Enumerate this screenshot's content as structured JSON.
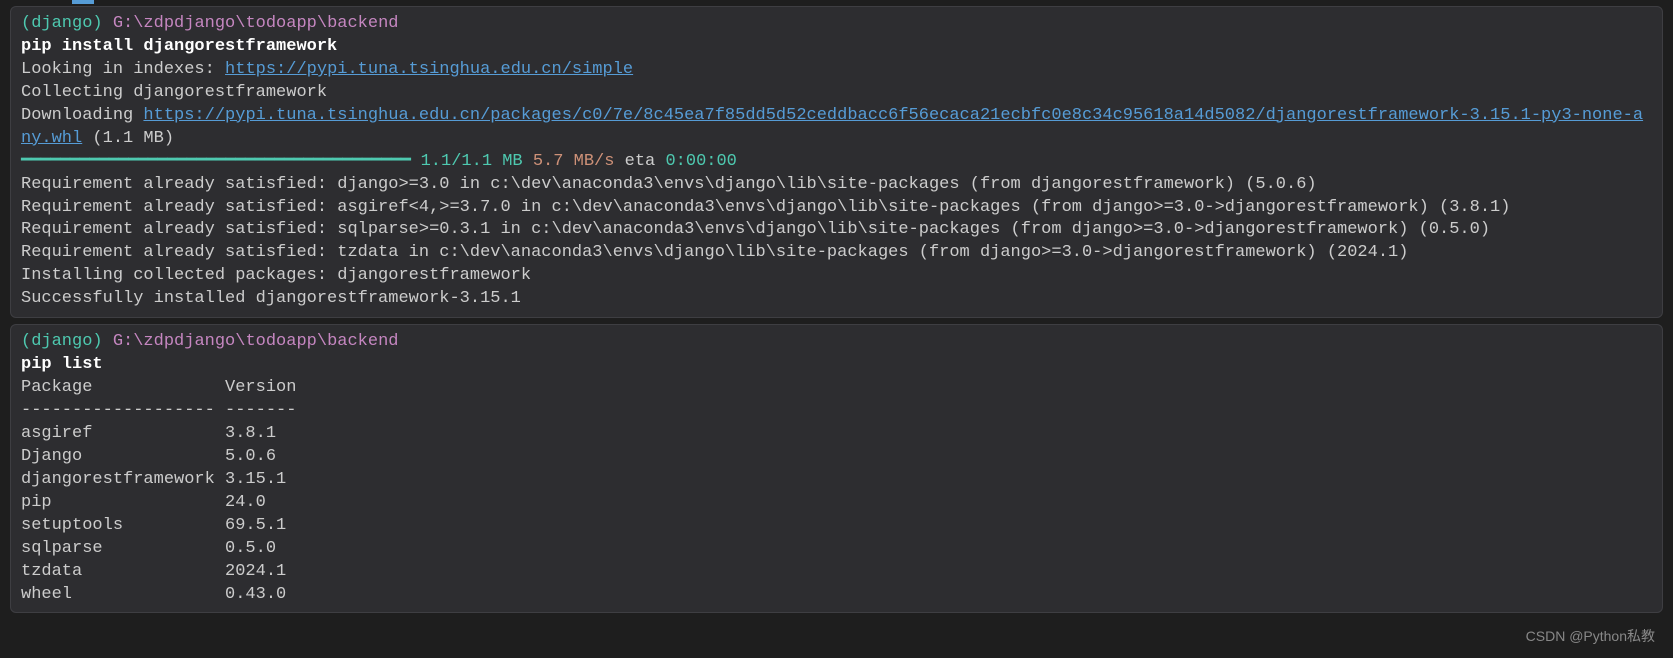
{
  "block1": {
    "prompt_env": "(django)",
    "prompt_path": "G:\\zdpdjango\\todoapp\\backend",
    "command": "pip install djangorestframework",
    "looking_in": "Looking in indexes: ",
    "index_url": "https://pypi.tuna.tsinghua.edu.cn/simple",
    "collecting": "Collecting djangorestframework",
    "downloading_prefix": "  Downloading ",
    "download_url": "https://pypi.tuna.tsinghua.edu.cn/packages/c0/7e/8c45ea7f85dd5d52ceddbacc6f56ecaca21ecbfc0e8c34c95618a14d5082/djangorestframework-3.15.1-py3-none-any.whl",
    "download_size": " (1.1 MB)",
    "progress_bar": "     ━━━━━━━━━━━━━━━━━━━━━━━━━━━━━━━━━━━━━━━━",
    "progress_size": " 1.1/1.1 MB",
    "progress_speed": " 5.7 MB/s",
    "eta_label": " eta ",
    "eta_time": "0:00:00",
    "req1": "Requirement already satisfied: django>=3.0 in c:\\dev\\anaconda3\\envs\\django\\lib\\site-packages (from djangorestframework) (5.0.6)",
    "req2": "Requirement already satisfied: asgiref<4,>=3.7.0 in c:\\dev\\anaconda3\\envs\\django\\lib\\site-packages (from django>=3.0->djangorestframework) (3.8.1)",
    "req3": "Requirement already satisfied: sqlparse>=0.3.1 in c:\\dev\\anaconda3\\envs\\django\\lib\\site-packages (from django>=3.0->djangorestframework) (0.5.0)",
    "req4": "Requirement already satisfied: tzdata in c:\\dev\\anaconda3\\envs\\django\\lib\\site-packages (from django>=3.0->djangorestframework) (2024.1)",
    "installing": "Installing collected packages: djangorestframework",
    "success": "Successfully installed djangorestframework-3.15.1"
  },
  "block2": {
    "prompt_env": "(django)",
    "prompt_path": "G:\\zdpdjango\\todoapp\\backend",
    "command": "pip list",
    "header": "Package             Version",
    "divider": "------------------- -------",
    "row0": "asgiref             3.8.1",
    "row1": "Django              5.0.6",
    "row2": "djangorestframework 3.15.1",
    "row3": "pip                 24.0",
    "row4": "setuptools          69.5.1",
    "row5": "sqlparse            0.5.0",
    "row6": "tzdata              2024.1",
    "row7": "wheel               0.43.0"
  },
  "watermark": "CSDN @Python私教"
}
